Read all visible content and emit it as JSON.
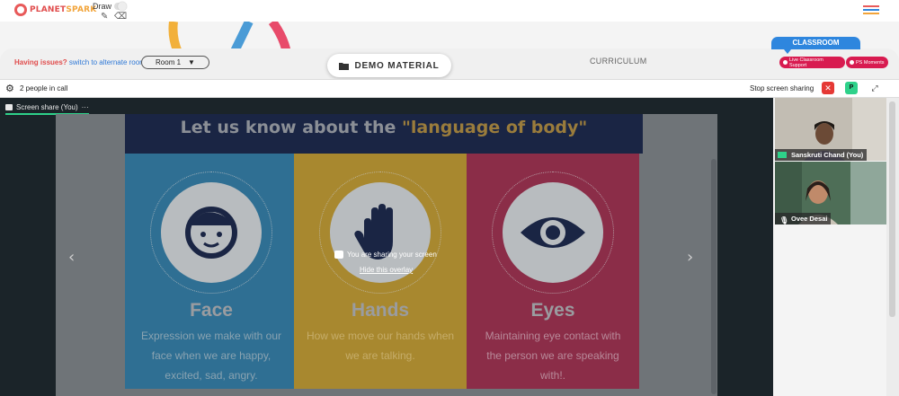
{
  "brand": {
    "logo_text_a": "PLANET",
    "logo_text_b": "SPARK"
  },
  "draw": {
    "label": "Draw"
  },
  "toolbar": {
    "issues_label": "Having issues?",
    "alt_room_link": "switch to alternate room",
    "room_select_value": "Room 1",
    "demo_material_label": "DEMO MATERIAL",
    "curriculum_label": "CURRICULUM",
    "classroom_tab": "CLASSROOM",
    "live_support_label": "Live Classroom Support",
    "ps_moments_label": "PS Moments"
  },
  "call": {
    "people_count": "2 people in call",
    "stop_sharing_label": "Stop screen sharing",
    "p_button_label": "P"
  },
  "screen_share": {
    "tab_label": "Screen share (You)",
    "tab_menu": "···"
  },
  "slide": {
    "title_a": "Let us know about the",
    "title_b": "\"language of body\"",
    "panels": [
      {
        "title": "Face",
        "desc": "Expression we make with our face when we are happy, excited, sad, angry.",
        "color": "#2f6f93"
      },
      {
        "title": "Hands",
        "desc": "How we move our hands when we are talking.",
        "color": "#a8882f"
      },
      {
        "title": "Eyes",
        "desc": "Maintaining eye contact with the person we are speaking with!.",
        "color": "#8b2d48"
      }
    ]
  },
  "overlay": {
    "message": "You are sharing your screen",
    "hide_link": "Hide this overlay"
  },
  "participants": [
    {
      "name": "Sanskruti Chand (You)"
    },
    {
      "name": "Ovee Desai"
    }
  ],
  "colors": {
    "accent_blue": "#2e86de",
    "accent_pink": "#d81b50",
    "accent_green": "#2ed18a",
    "stop_red": "#e53935"
  }
}
